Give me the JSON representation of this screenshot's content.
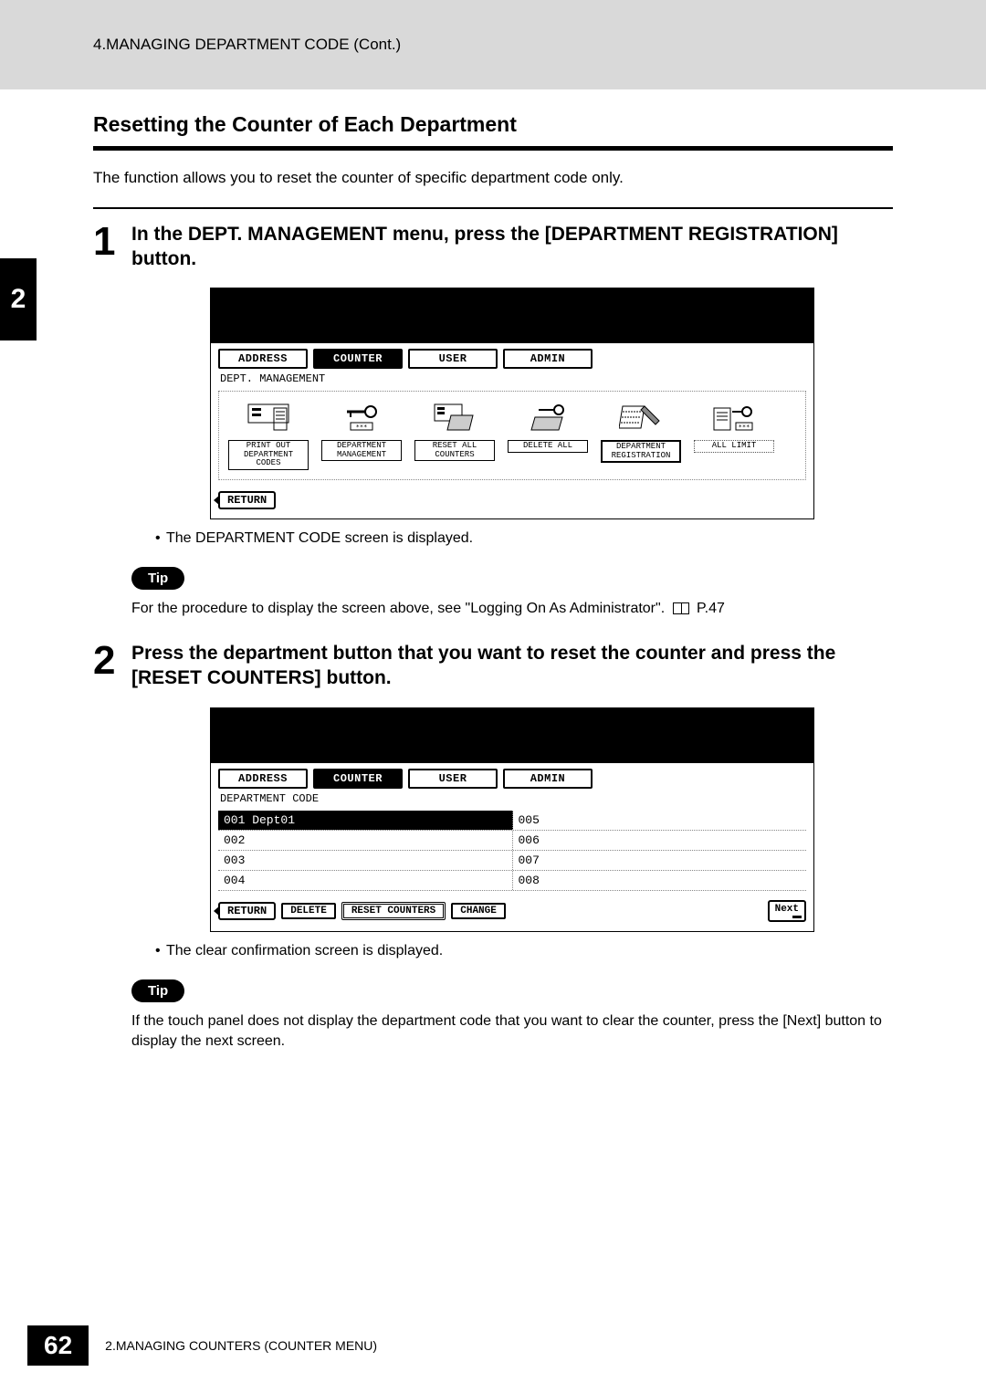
{
  "header": {
    "breadcrumb": "4.MANAGING DEPARTMENT CODE (Cont.)"
  },
  "chapter_tab": "2",
  "section_title": "Resetting the Counter of Each Department",
  "intro": "The function allows you to reset the counter of specific department code only.",
  "step1": {
    "num": "1",
    "heading": "In the DEPT. MANAGEMENT menu, press the [DEPARTMENT REGISTRATION] button.",
    "screenshot": {
      "tabs": {
        "address": "ADDRESS",
        "counter": "COUNTER",
        "user": "USER",
        "admin": "ADMIN"
      },
      "sub_label": "DEPT. MANAGEMENT",
      "buttons": {
        "print_out": "PRINT OUT DEPARTMENT CODES",
        "dept_mgmt": "DEPARTMENT MANAGEMENT",
        "reset_all": "RESET ALL COUNTERS",
        "delete_all": "DELETE ALL",
        "dept_reg": "DEPARTMENT REGISTRATION",
        "all_limit": "ALL LIMIT"
      },
      "return": "RETURN"
    },
    "bullet": "The DEPARTMENT CODE screen is displayed.",
    "tip_label": "Tip",
    "tip_text_a": "For the procedure to display the screen above, see \"Logging On As Administrator\".",
    "tip_page_ref": "P.47"
  },
  "step2": {
    "num": "2",
    "heading": "Press the department button that you want to reset the counter and press the [RESET COUNTERS] button.",
    "screenshot": {
      "tabs": {
        "address": "ADDRESS",
        "counter": "COUNTER",
        "user": "USER",
        "admin": "ADMIN"
      },
      "sub_label": "DEPARTMENT CODE",
      "rows": [
        {
          "left": "001 Dept01",
          "right": "005"
        },
        {
          "left": "002",
          "right": "006"
        },
        {
          "left": "003",
          "right": "007"
        },
        {
          "left": "004",
          "right": "008"
        }
      ],
      "actions": {
        "return": "RETURN",
        "delete": "DELETE",
        "reset_counters": "RESET COUNTERS",
        "change": "CHANGE",
        "next": "Next"
      }
    },
    "bullet": "The clear confirmation screen is displayed.",
    "tip_label": "Tip",
    "tip_text": "If the touch panel does not display the department code that you want to clear the counter, press the [Next] button to display the next screen."
  },
  "footer": {
    "page_number": "62",
    "chapter": "2.MANAGING COUNTERS (COUNTER MENU)"
  }
}
